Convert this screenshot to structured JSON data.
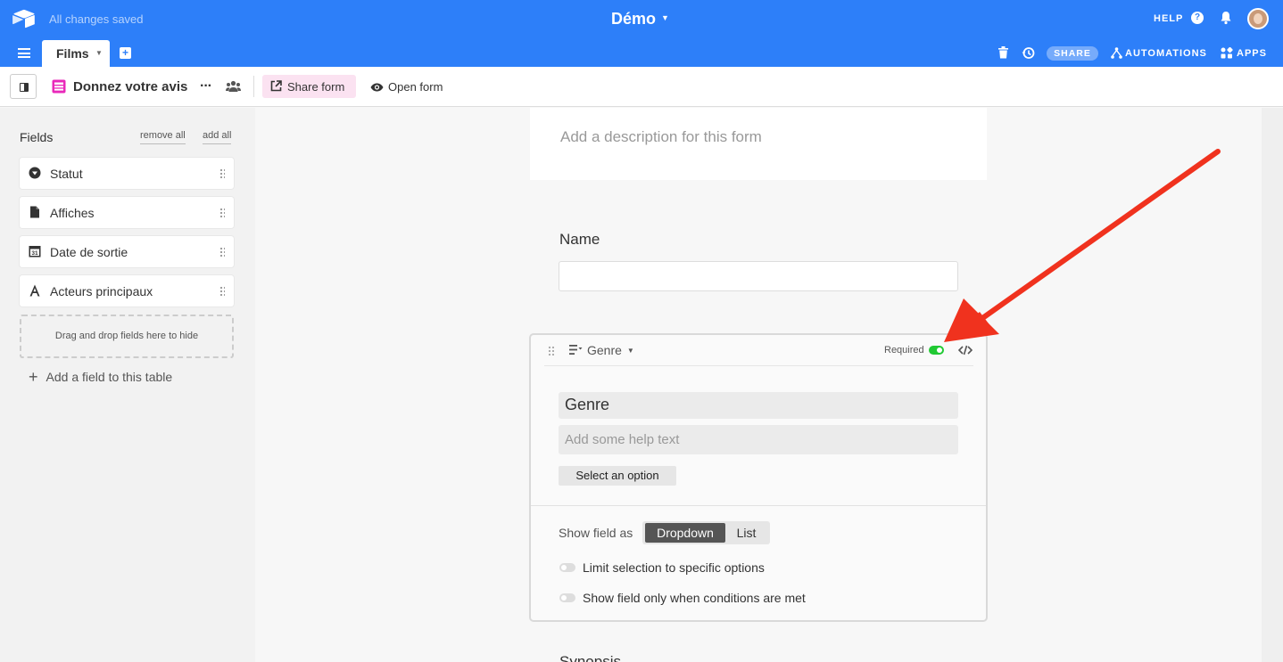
{
  "topbar": {
    "save_status": "All changes saved",
    "base_name": "Démo",
    "help_label": "HELP",
    "share_label": "SHARE",
    "automations_label": "AUTOMATIONS",
    "apps_label": "APPS",
    "accent_color": "#2d7ff9"
  },
  "tabs": [
    {
      "label": "Films",
      "active": true
    }
  ],
  "viewbar": {
    "view_name": "Donnez votre avis",
    "share_form_label": "Share form",
    "open_form_label": "Open form"
  },
  "fields_panel": {
    "title": "Fields",
    "remove_all": "remove all",
    "add_all": "add all",
    "hidden_fields": [
      {
        "label": "Statut",
        "icon": "dropdown-circle-icon"
      },
      {
        "label": "Affiches",
        "icon": "file-icon"
      },
      {
        "label": "Date de sortie",
        "icon": "calendar-icon"
      },
      {
        "label": "Acteurs principaux",
        "icon": "text-icon"
      }
    ],
    "drop_hint": "Drag and drop fields here to hide",
    "add_field": "Add a field to this table"
  },
  "form": {
    "description_placeholder": "Add a description for this form",
    "name_field_label": "Name",
    "genre_card": {
      "field_type": "Genre",
      "required_label": "Required",
      "required": true,
      "label_value": "Genre",
      "help_placeholder": "Add some help text",
      "select_button": "Select an option",
      "show_field_as_label": "Show field as",
      "show_options": [
        "Dropdown",
        "List"
      ],
      "selected_show_option": "Dropdown",
      "option_limit_label": "Limit selection to specific options",
      "option_conditions_label": "Show field only when conditions are met"
    },
    "next_field_label": "Synopsis"
  }
}
